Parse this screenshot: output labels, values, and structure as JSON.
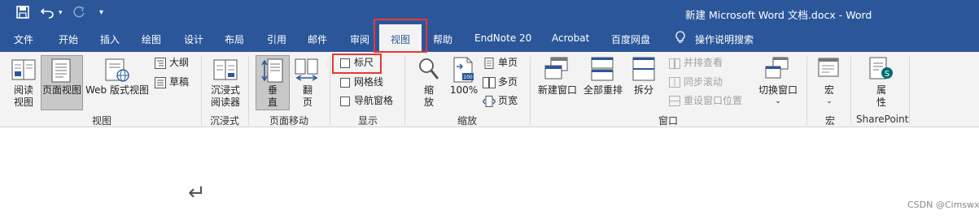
{
  "window": {
    "title": "新建 Microsoft Word 文档.docx  -  Word"
  },
  "quick_access": [
    {
      "icon": "save-icon"
    },
    {
      "icon": "undo-icon"
    },
    {
      "icon": "redo-icon"
    },
    {
      "icon": "customize-quick-access-icon"
    }
  ],
  "tabs": [
    "文件",
    "开始",
    "插入",
    "绘图",
    "设计",
    "布局",
    "引用",
    "邮件",
    "审阅",
    "视图",
    "帮助",
    "EndNote 20",
    "Acrobat",
    "百度网盘",
    "操作说明搜索"
  ],
  "active_tab": "视图",
  "ribbon": {
    "views": {
      "group_label": "视图",
      "read_mode": "阅读\n视图",
      "print_layout": "页面视图",
      "web_layout": "Web 版式视图",
      "outline": "大纲",
      "draft": "草稿"
    },
    "immersive": {
      "group_label": "沉浸式",
      "immersive_reader": "沉浸式\n阅读器"
    },
    "page_movement": {
      "group_label": "页面移动",
      "vertical": "垂\n直",
      "side_to_side": "翻\n页"
    },
    "show": {
      "group_label": "显示",
      "ruler": "标尺",
      "gridlines": "网格线",
      "nav_pane": "导航窗格"
    },
    "zoom": {
      "group_label": "缩放",
      "zoom": "缩\n放",
      "zoom_100": "100%",
      "one_page": "单页",
      "multiple_pages": "多页",
      "page_width": "页宽"
    },
    "window": {
      "group_label": "窗口",
      "new_window": "新建窗口",
      "arrange_all": "全部重排",
      "split": "拆分",
      "view_side_by_side": "并排查看",
      "sync_scrolling": "同步滚动",
      "reset_window_position": "重设窗口位置",
      "switch_windows": "切换窗口"
    },
    "macros": {
      "group_label": "宏",
      "macros": "宏"
    },
    "sharepoint": {
      "group_label": "SharePoint",
      "properties": "属\n性"
    }
  },
  "document": {
    "paragraph_mark": "↵"
  },
  "watermark": "CSDN @Cimswxy",
  "colors": {
    "title_bar": "#2b579a",
    "ribbon_bg": "#f3f3f3",
    "highlight_box": "#e53935"
  }
}
